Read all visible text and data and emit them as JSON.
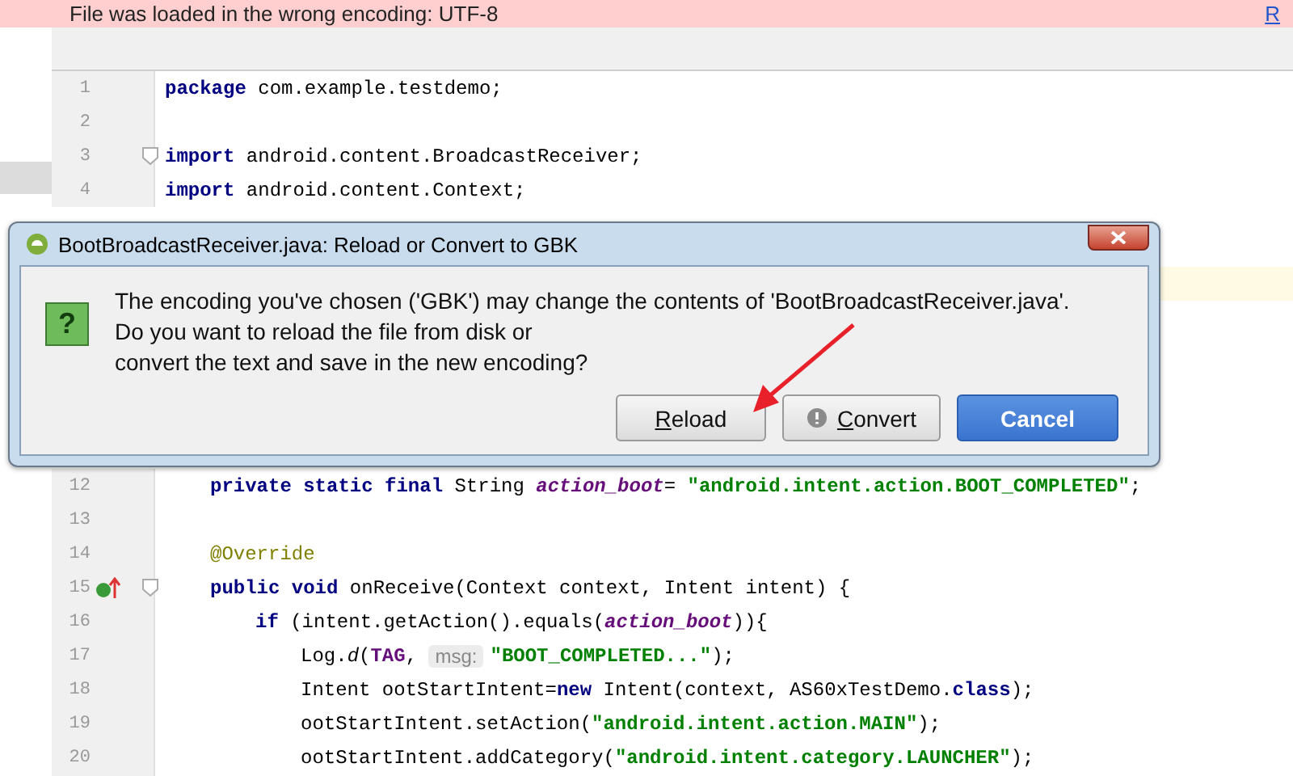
{
  "banner": {
    "message": "File was loaded in the wrong encoding:  UTF-8",
    "link": "R"
  },
  "editor": {
    "lines_top": [
      {
        "number": "1",
        "tokens": [
          {
            "text": "package",
            "kind": "keyword"
          },
          {
            "text": " com.example.testdemo;",
            "kind": "plain"
          }
        ]
      },
      {
        "number": "2"
      },
      {
        "number": "3",
        "fold": true,
        "tokens": [
          {
            "text": "import",
            "kind": "keyword"
          },
          {
            "text": " android.content.BroadcastReceiver;",
            "kind": "plain"
          }
        ]
      },
      {
        "number": "4",
        "tokens": [
          {
            "text": "import",
            "kind": "keyword"
          },
          {
            "text": " android.content.Context;",
            "kind": "plain"
          }
        ]
      }
    ],
    "lines_bottom": [
      {
        "number": "12",
        "tokens": [
          {
            "text": "private static final",
            "kind": "keyword"
          },
          {
            "text": " String ",
            "kind": "plain"
          },
          {
            "text": "action_boot",
            "kind": "field"
          },
          {
            "text": "= ",
            "kind": "plain"
          },
          {
            "text": "\"android.intent.action.BOOT_COMPLETED\"",
            "kind": "string"
          },
          {
            "text": ";",
            "kind": "plain"
          }
        ]
      },
      {
        "number": "13"
      },
      {
        "number": "14",
        "tokens": [
          {
            "text": "@Override",
            "kind": "annotation"
          }
        ]
      },
      {
        "number": "15",
        "fold": true,
        "marker": true,
        "tokens": [
          {
            "text": "public void",
            "kind": "keyword"
          },
          {
            "text": " onReceive(Context context, Intent intent) {",
            "kind": "plain"
          }
        ],
        "children": [
          {
            "number": "16",
            "tokens": [
              {
                "text": "if",
                "kind": "keyword"
              },
              {
                "text": " (intent.getAction().equals(",
                "kind": "plain"
              },
              {
                "text": "action_boot",
                "kind": "field"
              },
              {
                "text": ")){",
                "kind": "plain"
              }
            ],
            "children": [
              {
                "number": "17",
                "tokens": [
                  {
                    "text": "Log.",
                    "kind": "plain"
                  },
                  {
                    "text": "d",
                    "kind": "static"
                  },
                  {
                    "text": "(",
                    "kind": "plain"
                  },
                  {
                    "text": "TAG",
                    "kind": "constant"
                  },
                  {
                    "text": ", ",
                    "kind": "plain"
                  },
                  {
                    "text": "msg:",
                    "kind": "hint"
                  },
                  {
                    "text": "\"BOOT_COMPLETED...\"",
                    "kind": "string"
                  },
                  {
                    "text": ");",
                    "kind": "plain"
                  }
                ]
              },
              {
                "number": "18",
                "tokens": [
                  {
                    "text": "Intent ootStartIntent=",
                    "kind": "plain"
                  },
                  {
                    "text": "new",
                    "kind": "keyword"
                  },
                  {
                    "text": " Intent(context, AS60xTestDemo.",
                    "kind": "plain"
                  },
                  {
                    "text": "class",
                    "kind": "keyword"
                  },
                  {
                    "text": ");",
                    "kind": "plain"
                  }
                ]
              },
              {
                "number": "19",
                "tokens": [
                  {
                    "text": "ootStartIntent.setAction(",
                    "kind": "plain"
                  },
                  {
                    "text": "\"android.intent.action.MAIN\"",
                    "kind": "string"
                  },
                  {
                    "text": ");",
                    "kind": "plain"
                  }
                ]
              },
              {
                "number": "20",
                "tokens": [
                  {
                    "text": "ootStartIntent.addCategory(",
                    "kind": "plain"
                  },
                  {
                    "text": "\"android.intent.category.LAUNCHER\"",
                    "kind": "string"
                  },
                  {
                    "text": ");",
                    "kind": "plain"
                  }
                ]
              }
            ]
          }
        ]
      }
    ]
  },
  "dialog": {
    "title": "BootBroadcastReceiver.java: Reload or Convert to GBK",
    "message": [
      "The encoding you've chosen ('GBK') may change the contents of 'BootBroadcastReceiver.java'.",
      "Do you want to reload the file from disk or",
      "convert the text and save in the new encoding?"
    ],
    "question_mark": "?",
    "buttons": [
      {
        "label": "Reload",
        "default": false,
        "mnemonic": true,
        "kind": "plain"
      },
      {
        "label": "Convert",
        "default": false,
        "mnemonic": true,
        "kind": "warning"
      },
      {
        "label": "Cancel",
        "default": true,
        "mnemonic": false,
        "kind": "plain"
      }
    ]
  }
}
